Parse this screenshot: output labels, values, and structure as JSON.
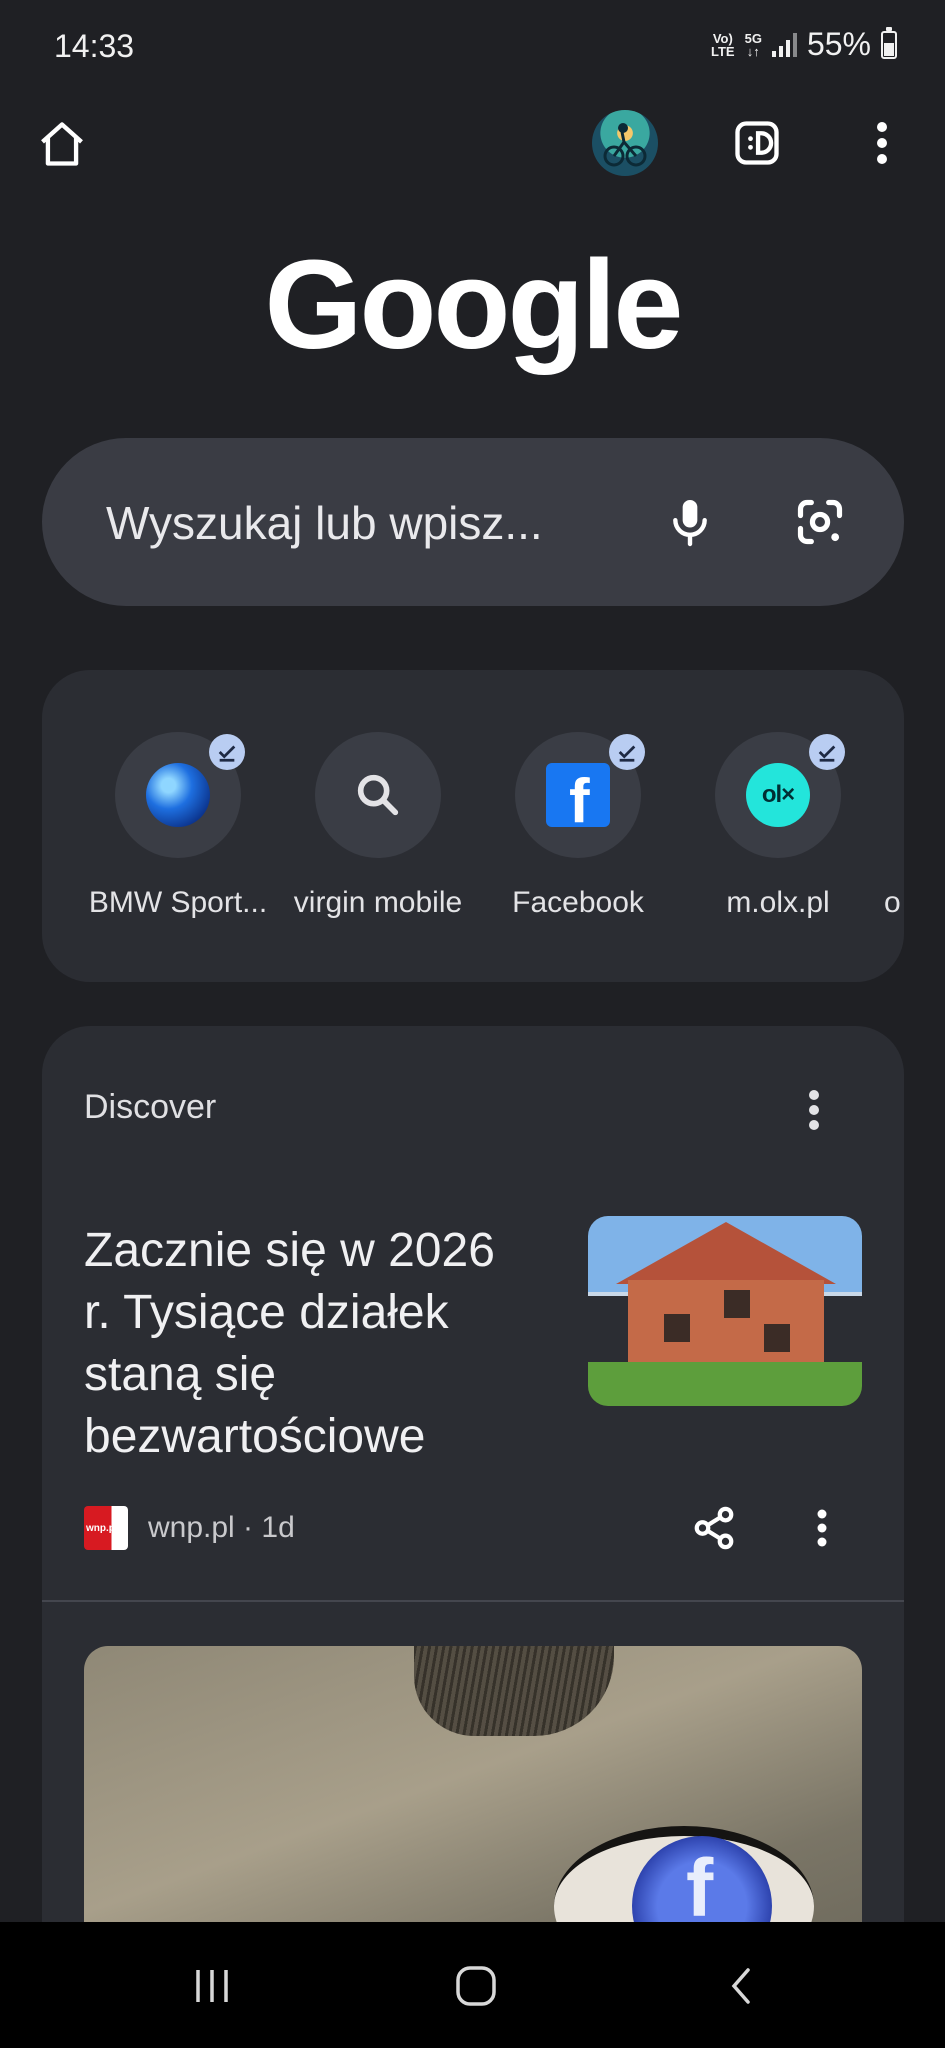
{
  "status_bar": {
    "time": "14:33",
    "volte_line1": "Vo)",
    "volte_line2": "LTE",
    "network_line1": "5G",
    "network_line2": "↓↑",
    "battery": "55%"
  },
  "toolbar": {
    "home_icon": "home-icon",
    "avatar_icon": "profile-avatar",
    "incognito_icon": "incognito-icon",
    "menu_icon": "more-vert-icon"
  },
  "logo": "Google",
  "search": {
    "placeholder": "Wyszukaj lub wpisz...",
    "mic_icon": "microphone-icon",
    "lens_icon": "camera-lens-icon"
  },
  "shortcuts": [
    {
      "label": "BMW Sport...",
      "icon": "bmw-globe-icon",
      "checked": true
    },
    {
      "label": "virgin mobile",
      "icon": "search-icon",
      "checked": false
    },
    {
      "label": "Facebook",
      "icon": "facebook-icon",
      "checked": true
    },
    {
      "label": "m.olx.pl",
      "icon": "olx-icon",
      "checked": true
    }
  ],
  "shortcut_partial_label": "o",
  "olx_logo_text": "ol×",
  "discover": {
    "title": "Discover",
    "article": {
      "title": "Zacznie się w 2026 r. Tysiące działek staną się bezwartościowe",
      "source": "wnp.pl · 1d",
      "source_logo_text": "wnp.pl"
    }
  },
  "colors": {
    "background": "#1f2024",
    "card": "#2b2d33",
    "search_box": "#3a3c44",
    "check_badge": "#b9cdf2"
  }
}
